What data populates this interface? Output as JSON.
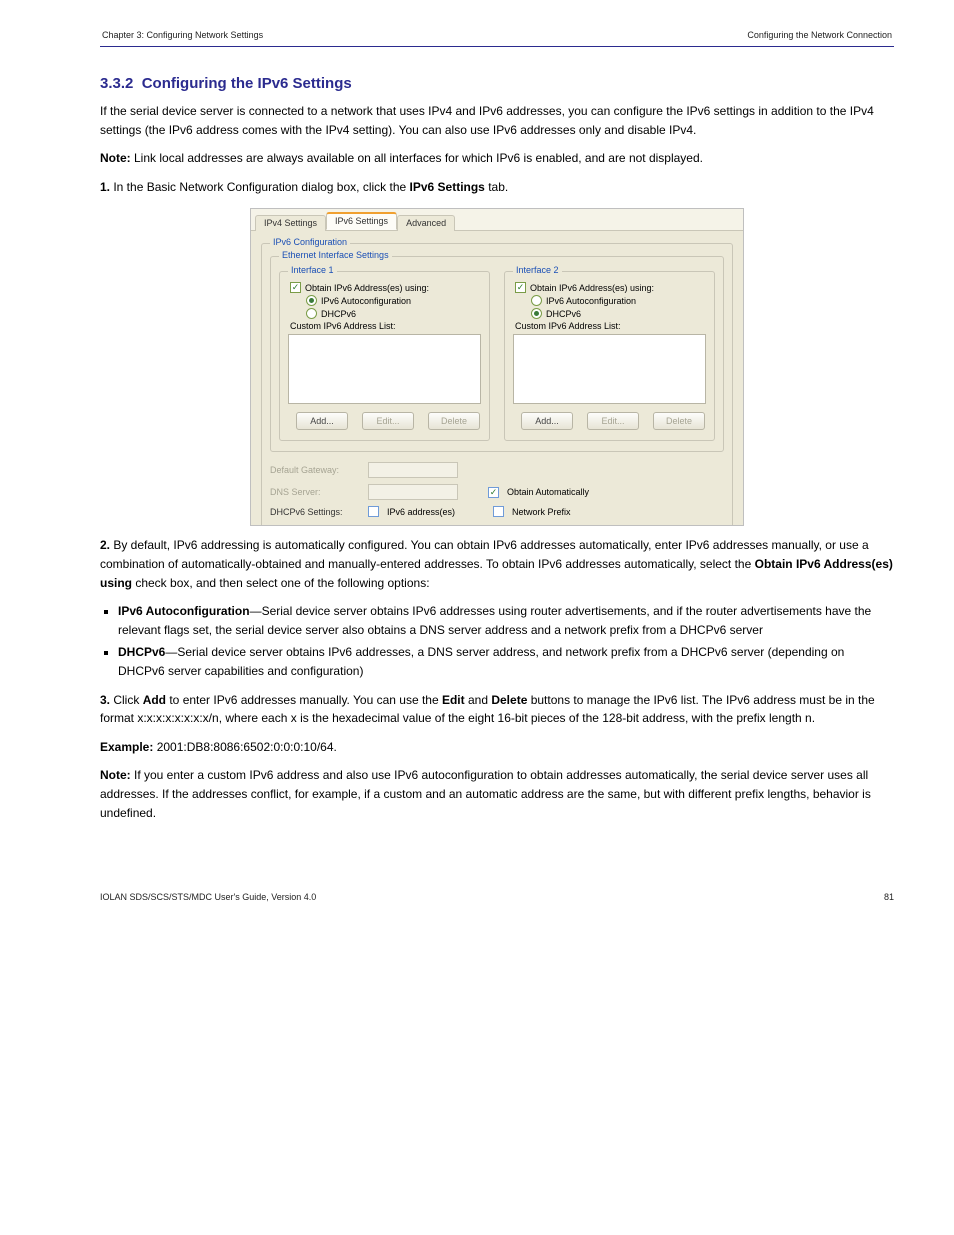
{
  "header": {
    "chapter": "Chapter 3: Configuring Network Settings",
    "topic": "Configuring the Network Connection"
  },
  "sec": {
    "num": "3.3.2",
    "title": "Configuring the IPv6 Settings",
    "p1": "If the serial device server is connected to a network that uses IPv4 and IPv6 addresses, you can configure the IPv6 settings in addition to the IPv4 settings (the IPv6 address comes with the IPv4 setting). You can also use IPv6 addresses only and disable IPv4.",
    "note": "Link local addresses are always available on all interfaces for which IPv6 is enabled, and are not displayed.",
    "step1": "In the Basic Network Configuration dialog box, click the ",
    "step1_bold": "IPv6 Settings",
    "step1_after": " tab."
  },
  "screenshot": {
    "tabs": {
      "ipv4": "IPv4 Settings",
      "ipv6": "IPv6 Settings",
      "adv": "Advanced"
    },
    "group_config": "IPv6 Configuration",
    "group_eth": "Ethernet Interface Settings",
    "iface1": "Interface 1",
    "iface2": "Interface 2",
    "obtain": "Obtain IPv6 Address(es) using:",
    "autoconf": "IPv6 Autoconfiguration",
    "dhcpv6": "DHCPv6",
    "customlist": "Custom IPv6 Address List:",
    "add": "Add...",
    "edit": "Edit...",
    "delete": "Delete",
    "defgw": "Default Gateway:",
    "dns": "DNS Server:",
    "obtain_auto": "Obtain Automatically",
    "dhcpv6_settings": "DHCPv6 Settings:",
    "ipv6_addr": "IPv6 address(es)",
    "net_prefix": "Network Prefix"
  },
  "after": {
    "step2_a": "By default, IPv6 addressing is automatically configured. You can obtain IPv6 addresses automatically, enter IPv6 addresses manually, or use a combination of automatically-obtained and manually-entered addresses. To obtain IPv6 addresses automatically, select the ",
    "step2_b": "Obtain IPv6 Address(es) using",
    "step2_c": " check box, and then select one of the following options:",
    "bullets": [
      {
        "bold": "IPv6 Autoconfiguration",
        "rest": "—Serial device server obtains IPv6 addresses using router advertisements, and if the router advertisements have the relevant flags set, the serial device server also obtains a DNS server address and a network prefix from a DHCPv6 server"
      },
      {
        "bold": "DHCPv6",
        "rest": "—Serial device server obtains IPv6 addresses, a DNS server address, and network prefix from a DHCPv6 server (depending on DHCPv6 server capabilities and configuration)"
      }
    ],
    "step3_a": "Click ",
    "step3_b": "Add",
    "step3_c": " to enter IPv6 addresses manually. You can use the ",
    "step3_d": "Edit",
    "step3_e": " and ",
    "step3_f": "Delete",
    "step3_g": " buttons to manage the IPv6 list. The IPv6 address must be in the format x:x:x:x:x:x:x:x/n, where each x is the hexadecimal value of the eight 16-bit pieces of the 128-bit address, with the prefix length n.",
    "example_label": "Example:",
    "example_val": " 2001:DB8:8086:6502:0:0:0:10/64.",
    "note2": "If you enter a custom IPv6 address and also use IPv6 autoconfiguration to obtain addresses automatically, the serial device server uses all addresses. If the addresses conflict, for example, if a custom and an automatic address are the same, but with different prefix lengths, behavior is undefined."
  },
  "footer": {
    "doc": "IOLAN SDS/SCS/STS/MDC User's Guide, Version 4.0",
    "page": "81"
  }
}
